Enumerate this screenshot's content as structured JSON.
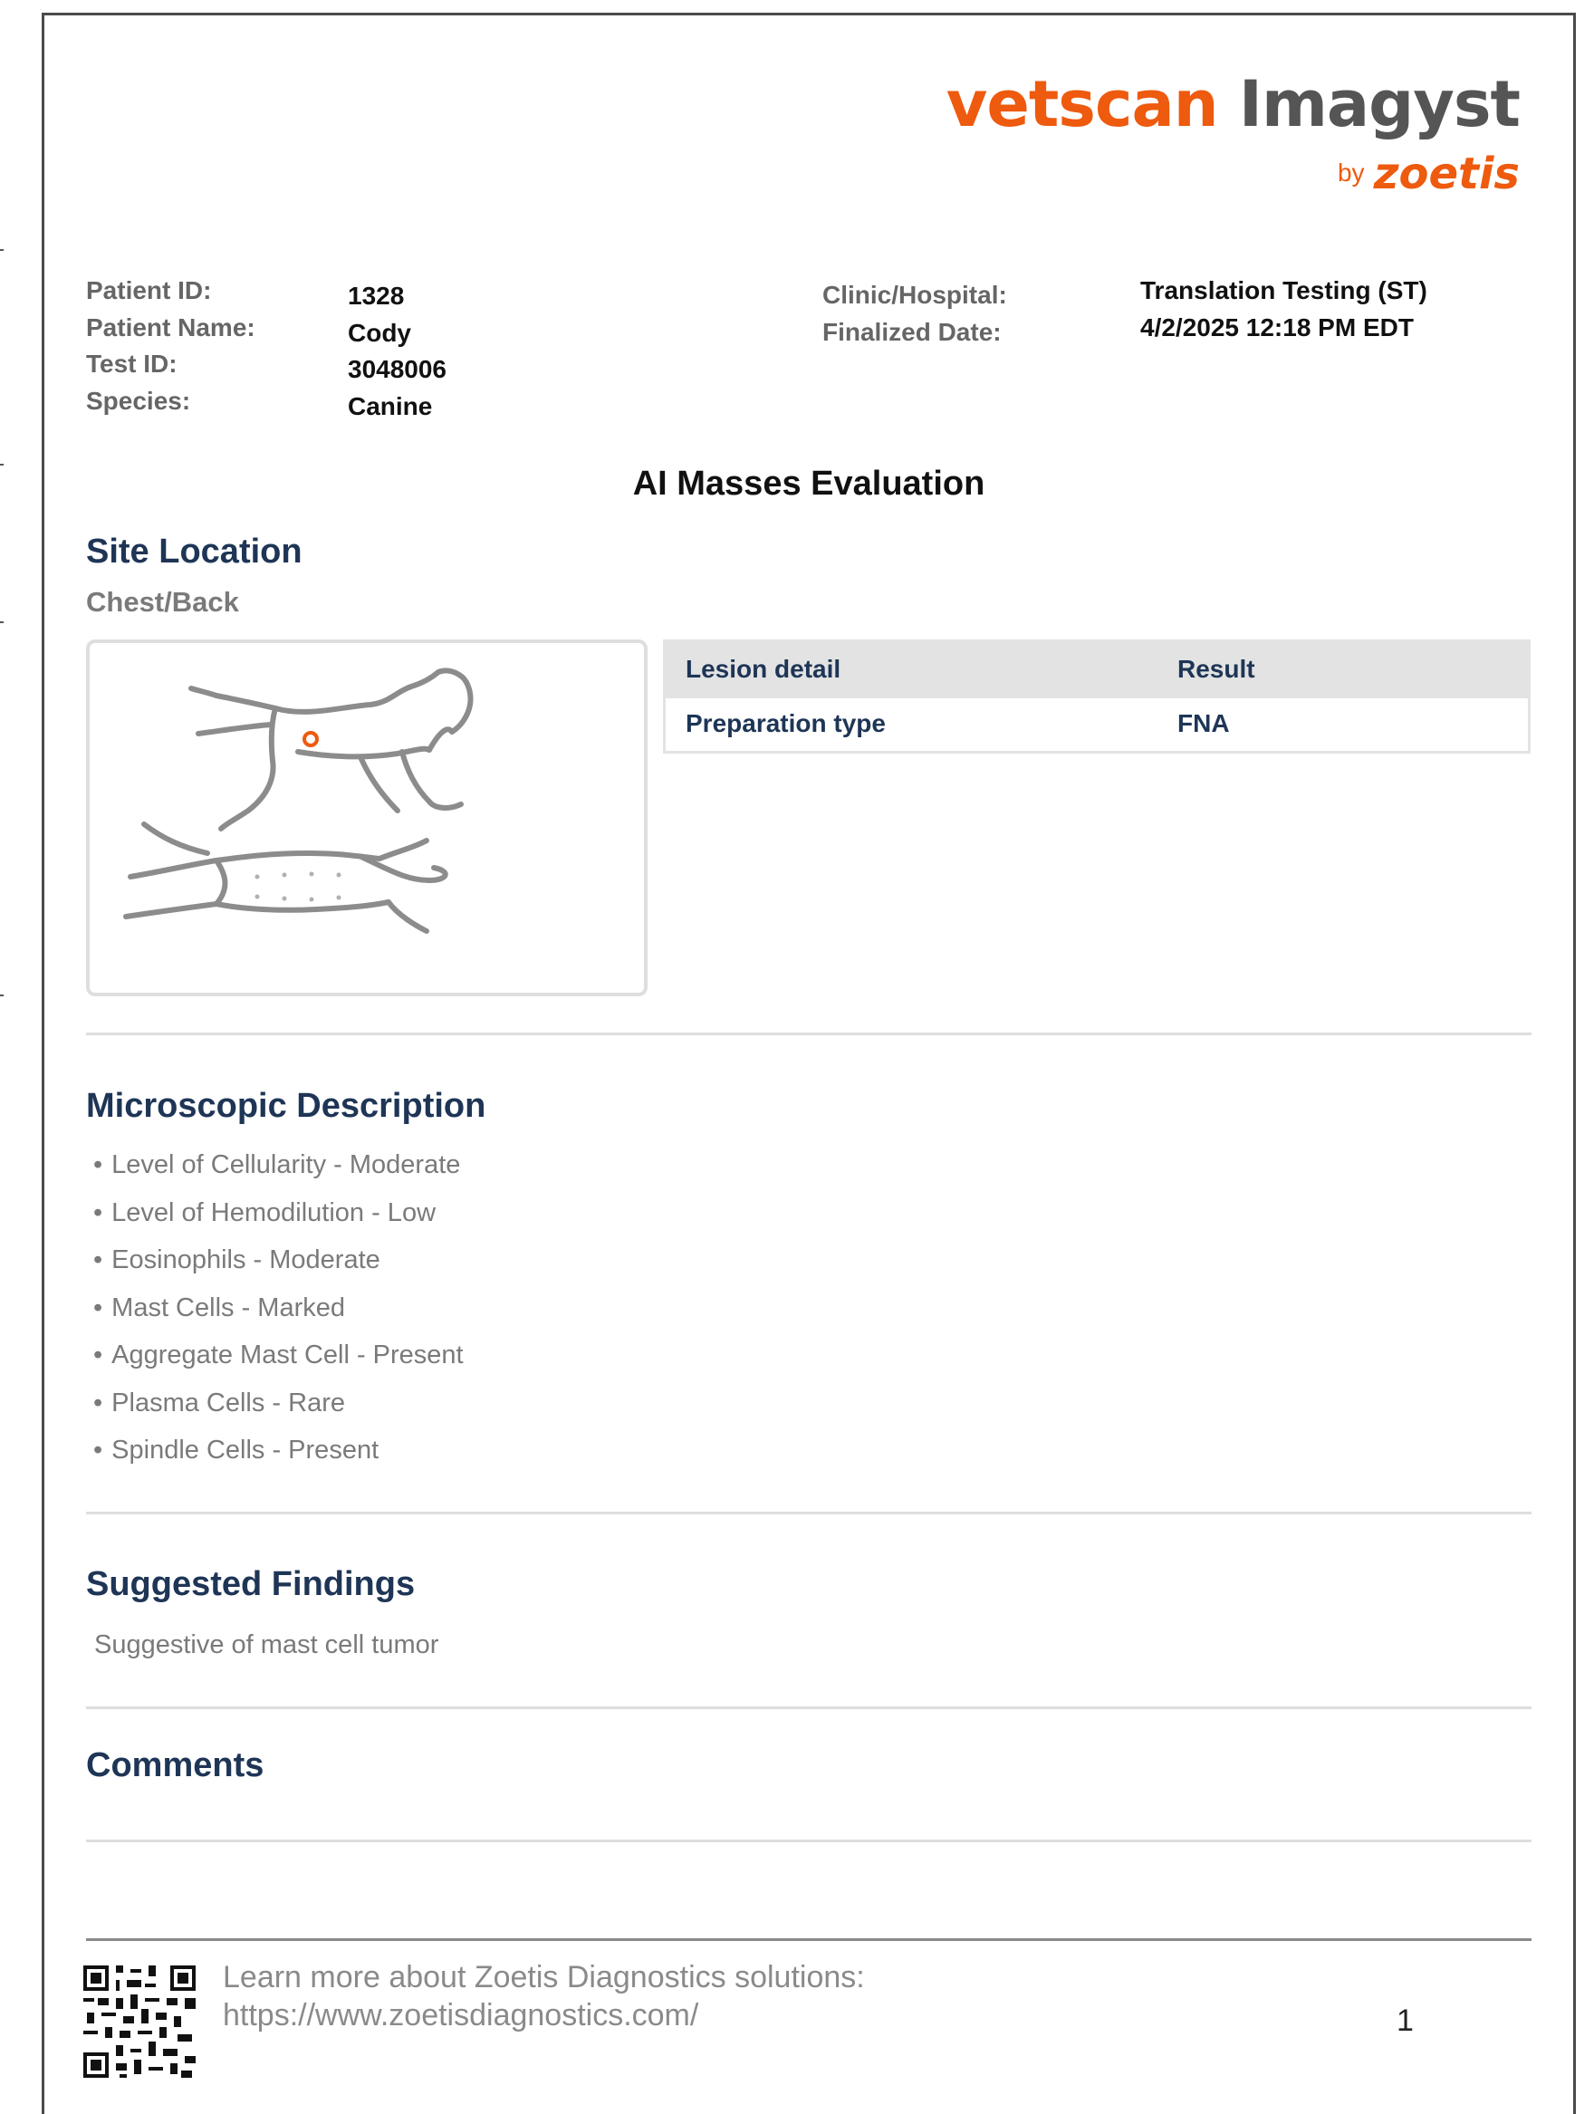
{
  "logo": {
    "brand": "vetscan",
    "product": "Imagyst",
    "by": "by",
    "company": "zoetis"
  },
  "patient": {
    "id_label": "Patient ID:",
    "id_value": "1328",
    "name_label": "Patient Name:",
    "name_value": "Cody",
    "test_label": "Test ID:",
    "test_value": "3048006",
    "species_label": "Species:",
    "species_value": "Canine",
    "clinic_label": "Clinic/Hospital:",
    "clinic_value": "Translation Testing (ST)",
    "date_label": "Finalized Date:",
    "date_value": "4/2/2025 12:18 PM EDT"
  },
  "report_title": "AI Masses Evaluation",
  "site_location": {
    "title": "Site Location",
    "location": "Chest/Back",
    "marker_color": "#ee5a0e"
  },
  "lesion_table": {
    "headers": [
      "Lesion detail",
      "Result"
    ],
    "rows": [
      [
        "Preparation type",
        "FNA"
      ]
    ]
  },
  "microscopic": {
    "title": "Microscopic Description",
    "bullet": "•",
    "items": [
      "Level of Cellularity - Moderate",
      "Level of Hemodilution - Low",
      "Eosinophils - Moderate",
      "Mast Cells - Marked",
      "Aggregate Mast Cell - Present",
      "Plasma Cells - Rare",
      "Spindle Cells - Present"
    ]
  },
  "findings": {
    "title": "Suggested Findings",
    "text": "Suggestive of mast cell tumor"
  },
  "comments": {
    "title": "Comments"
  },
  "footer": {
    "text_line1": "Learn more about Zoetis Diagnostics solutions:",
    "text_line2": "https://www.zoetisdiagnostics.com/",
    "page_number": "1"
  }
}
